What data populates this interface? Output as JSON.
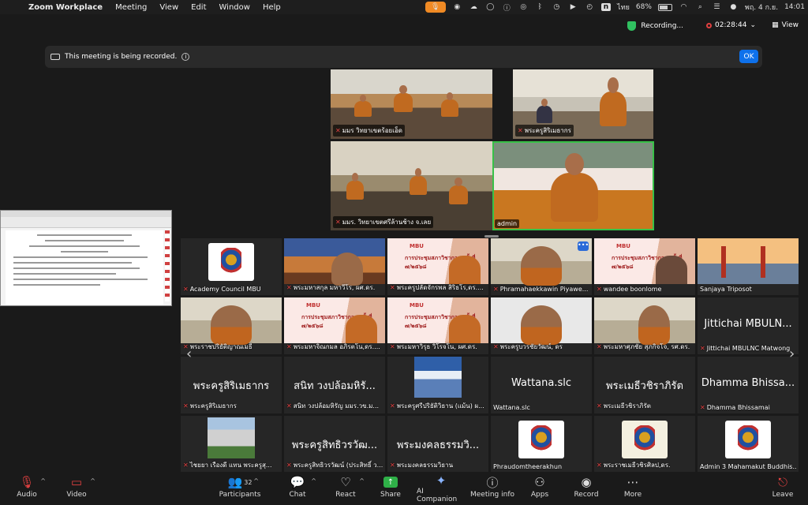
{
  "menubar": {
    "app_name": "Zoom Workplace",
    "menus": [
      "Meeting",
      "View",
      "Edit",
      "Window",
      "Help"
    ],
    "lang": "ไทย",
    "battery": "68%",
    "datetime": "พฤ. 4 ก.ย.",
    "clock": "14:01"
  },
  "zoom_top": {
    "recording": "Recording...",
    "elapsed": "02:28:44",
    "view": "View"
  },
  "banner": {
    "text": "This meeting is being recorded.",
    "ok": "OK"
  },
  "speakers": [
    {
      "name": "มมร วิทยาเขตร้อยเอ็ด"
    },
    {
      "name": "พระครูสิริเมธากร"
    },
    {
      "name": "มมร. วิทยาเขตศรีล้านช้าง จ.เลย"
    },
    {
      "name": "admin"
    }
  ],
  "gallery": {
    "slide_brand": "MBU",
    "slide_title": "การประชุมสภาวิชาการ ครั้งที่ ๗/๒๕๖๘",
    "tiles": [
      {
        "name": "Academy Council MBU"
      },
      {
        "name": "พระมหาสกุล มหาวีโร, ผศ.ดร."
      },
      {
        "name": "พระครูปลัดจักรพล สิริธโร,ดร...."
      },
      {
        "name": "Phramahaekkawin Piyawe..."
      },
      {
        "name": "wandee boonlome"
      },
      {
        "name": "Sanjaya Triposot"
      },
      {
        "name": "พระราชปริยัติญาณเมธี"
      },
      {
        "name": "พระมหาจิณกมล อภิรตโน,ดร...."
      },
      {
        "name": "พระมหาวิรุธ วิโรจโน, ผศ.ดร."
      },
      {
        "name": "พระครูบวรชัยวัฒน์, ดร"
      },
      {
        "name": "พระมหาศุภชัย สุภกิจโจ, รศ.ดร."
      },
      {
        "name": "Jittichai MBULNC Matwong",
        "big": "Jittichai MBULN..."
      },
      {
        "name": "พระครูสิริเมธากร",
        "big": "พระครูสิริเมธากร"
      },
      {
        "name": "สนิท วงปล้อมหิรัญ มมร.วข.ม...",
        "big": "สนิท วงปล้อมหิรั..."
      },
      {
        "name": "พระครูศรีปริยัติวิธาน (แม้น) ผ..."
      },
      {
        "name": "Wattana.slc",
        "big": "Wattana.slc"
      },
      {
        "name": "พระเมธีวชิราภิรัต",
        "big": "พระเมธีวชิราภิรัต"
      },
      {
        "name": "Dhamma Bhissamai",
        "big": "Dhamma Bhissa..."
      },
      {
        "name": "ไชยยา เรืองดี แทน พระครูสุ..."
      },
      {
        "name": "พระครูสิทธิวรวัฒน์ (ประสิทธิ์ ว...",
        "big": "พระครูสิทธิวรวัฒ..."
      },
      {
        "name": "พระมงคลธรรมวิธาน",
        "big": "พระมงคลธรรมวิ..."
      },
      {
        "name": "Phraudomtheerakhun"
      },
      {
        "name": "พระราชเมธีวชิรศิลป,ดร."
      },
      {
        "name": "Admin 3 Mahamakut Buddhis..."
      }
    ]
  },
  "toolbar": {
    "audio": "Audio",
    "video": "Video",
    "participants": "Participants",
    "participants_count": "32",
    "chat": "Chat",
    "react": "React",
    "share": "Share",
    "ai": "AI Companion",
    "info": "Meeting info",
    "apps": "Apps",
    "record": "Record",
    "more": "More",
    "leave": "Leave"
  },
  "colors": {
    "accent": "#0e71eb",
    "active_speaker": "#38c148",
    "muted": "#e04040",
    "share": "#2fb048",
    "mic_pill": "#f08a24"
  }
}
